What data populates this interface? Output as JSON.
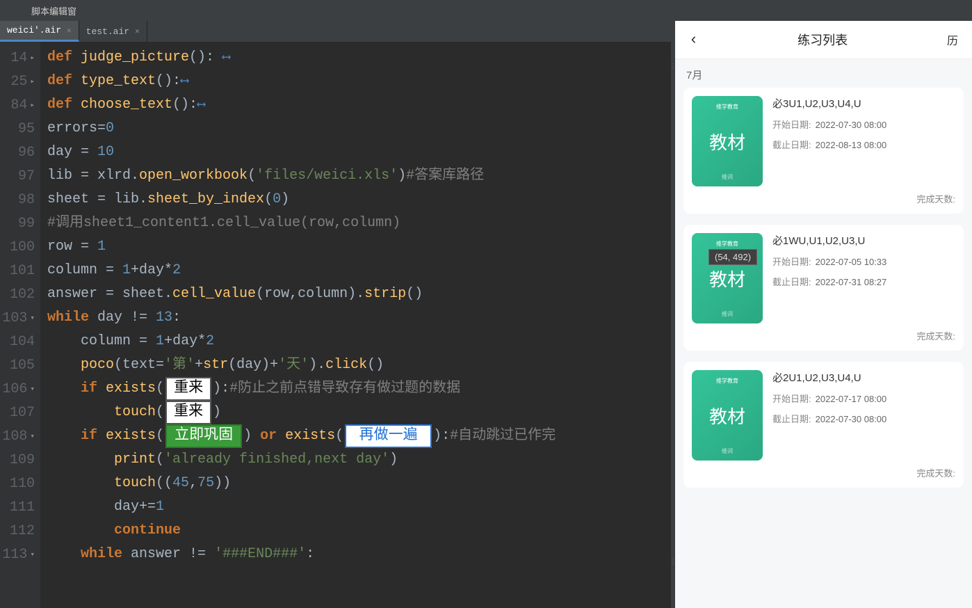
{
  "window": {
    "title": "脚本编辑窗"
  },
  "tabs": [
    {
      "name": "weici'.air",
      "active": true
    },
    {
      "name": "test.air",
      "active": false
    }
  ],
  "code": {
    "lines": [
      {
        "no": "14",
        "fold": "▸",
        "fn": "judge_picture"
      },
      {
        "no": "25",
        "fold": "▸",
        "fn": "type_text"
      },
      {
        "no": "84",
        "fold": "▸",
        "fn": "choose_text"
      },
      {
        "no": "95",
        "assign": "errors=",
        "num": "0"
      },
      {
        "no": "96",
        "assign": "day = ",
        "num": "10"
      },
      {
        "no": "97",
        "t1": "lib = xlrd.",
        "call": "open_workbook",
        "arg": "'files/weici.xls'",
        "cmt": "#答案库路径"
      },
      {
        "no": "98",
        "t1": "sheet = lib.",
        "call": "sheet_by_index",
        "arg_num": "0"
      },
      {
        "no": "99",
        "cmt": "#调用sheet1_content1.cell_value(row,column)"
      },
      {
        "no": "100",
        "assign": "row = ",
        "num": "1"
      },
      {
        "no": "101",
        "t1": "column = ",
        "num1": "1",
        "rest": "+day*",
        "num2": "2"
      },
      {
        "no": "102",
        "t1": "answer = sheet.",
        "call": "cell_value",
        "args": "(row,column).",
        "call2": "strip",
        "suffix": "()"
      },
      {
        "no": "103",
        "fold": "▾",
        "kw": "while",
        "cond": " day != ",
        "num": "13",
        "colon": ":"
      },
      {
        "no": "104",
        "indent": "    ",
        "t1": "column = ",
        "num1": "1",
        "rest": "+day*",
        "num2": "2"
      },
      {
        "no": "105",
        "indent": "    ",
        "call": "poco",
        "p1": "(text=",
        "s1": "'第'",
        "p2": "+",
        "call2": "str",
        "p3": "(day)+",
        "s2": "'天'",
        "p4": ").",
        "call3": "click",
        "p5": "()"
      },
      {
        "no": "106",
        "fold": "▾",
        "indent": "    ",
        "kw": "if",
        "sp": " ",
        "call": "exists",
        "p1": "(",
        "chip": "重来",
        "p2": "):",
        "cmt": "#防止之前点错导致存有做过题的数据"
      },
      {
        "no": "107",
        "indent": "        ",
        "call": "touch",
        "p1": "(",
        "chip": "重来",
        "p2": ")"
      },
      {
        "no": "108",
        "fold": "▾",
        "indent": "    ",
        "kw": "if",
        "sp": " ",
        "call": "exists",
        "p1": "(",
        "chip_green": "立即巩固",
        "p2": ") ",
        "kw2": "or",
        "sp2": " ",
        "call2": "exists",
        "p3": "(",
        "chip_blue": "再做一遍",
        "p4": "):",
        "cmt": "#自动跳过已作完"
      },
      {
        "no": "109",
        "indent": "        ",
        "call": "print",
        "p1": "(",
        "str": "'already finished,next day'",
        "p2": ")"
      },
      {
        "no": "110",
        "indent": "        ",
        "call": "touch",
        "p1": "((",
        "num1": "45",
        "comma": ",",
        "num2": "75",
        "p2": "))"
      },
      {
        "no": "111",
        "indent": "        ",
        "text": "day+=",
        "num": "1"
      },
      {
        "no": "112",
        "indent": "        ",
        "kw": "continue"
      },
      {
        "no": "113",
        "fold": "▾",
        "indent": "    ",
        "kw": "while",
        "cond": " answer != ",
        "str": "'###END###'",
        "colon": ":"
      }
    ]
  },
  "tooltip": "(54, 492)",
  "mobile": {
    "title": "练习列表",
    "right": "历",
    "month": "7月",
    "thumb": {
      "brand": "维学教育",
      "label": "教材",
      "footer": "维词"
    },
    "items": [
      {
        "title": "必3U1,U2,U3,U4,U",
        "start_label": "开始日期:",
        "start": "2022-07-30 08:00",
        "end_label": "截止日期:",
        "end": "2022-08-13 08:00",
        "footer": "完成天数:"
      },
      {
        "title": "必1WU,U1,U2,U3,U",
        "start_label": "开始日期:",
        "start": "2022-07-05 10:33",
        "end_label": "截止日期:",
        "end": "2022-07-31 08:27",
        "footer": "完成天数:"
      },
      {
        "title": "必2U1,U2,U3,U4,U",
        "start_label": "开始日期:",
        "start": "2022-07-17 08:00",
        "end_label": "截止日期:",
        "end": "2022-07-30 08:00",
        "footer": "完成天数:"
      }
    ]
  }
}
